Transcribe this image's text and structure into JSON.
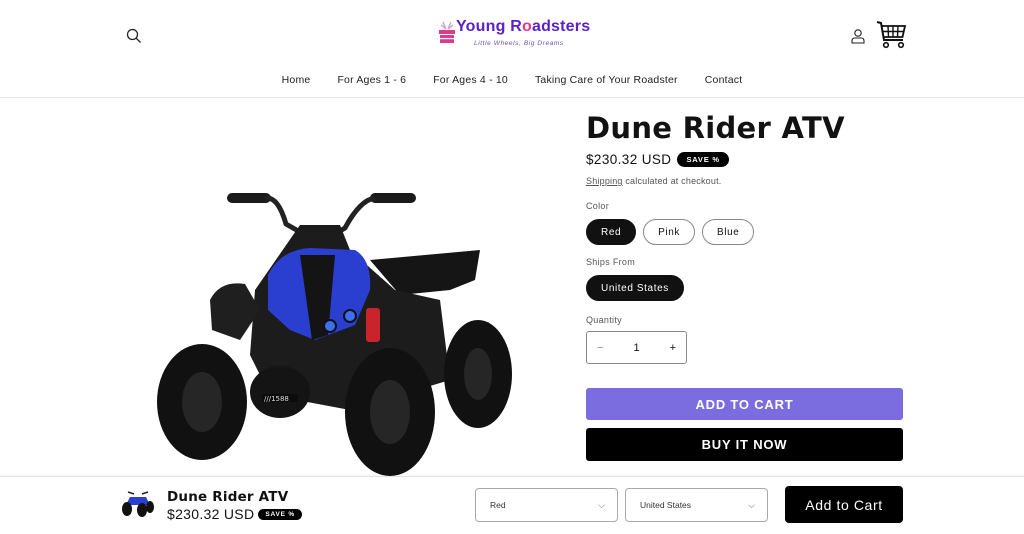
{
  "header": {
    "brand_part1": "Young R",
    "brand_part2": "o",
    "brand_part3": "adsters",
    "tagline": "Little Wheels, Big Dreams",
    "icons": {
      "search": "search-icon",
      "account": "account-icon",
      "cart": "cart-icon"
    }
  },
  "nav": {
    "items": [
      {
        "label": "Home"
      },
      {
        "label": "For Ages 1 - 6"
      },
      {
        "label": "For Ages 4 - 10"
      },
      {
        "label": "Taking Care of Your Roadster"
      },
      {
        "label": "Contact"
      }
    ]
  },
  "product": {
    "title": "Dune Rider ATV",
    "price": "$230.32 USD",
    "badge": "SAVE %",
    "shipping_link": "Shipping",
    "shipping_text": " calculated at checkout.",
    "color_label": "Color",
    "colors": [
      {
        "label": "Red",
        "selected": true
      },
      {
        "label": "Pink",
        "selected": false
      },
      {
        "label": "Blue",
        "selected": false
      }
    ],
    "ships_from_label": "Ships From",
    "ships_from": [
      {
        "label": "United States",
        "selected": true
      }
    ],
    "quantity_label": "Quantity",
    "quantity": "1",
    "quantity_minus": "−",
    "quantity_plus": "+",
    "add_to_cart": "ADD TO CART",
    "buy_now": "BUY IT NOW",
    "accent_color": "#7b6ce0"
  },
  "sticky_bar": {
    "title": "Dune Rider ATV",
    "price": "$230.32 USD",
    "badge": "SAVE %",
    "color_select": "Red",
    "ships_select": "United States",
    "add_to_cart": "Add to Cart"
  }
}
